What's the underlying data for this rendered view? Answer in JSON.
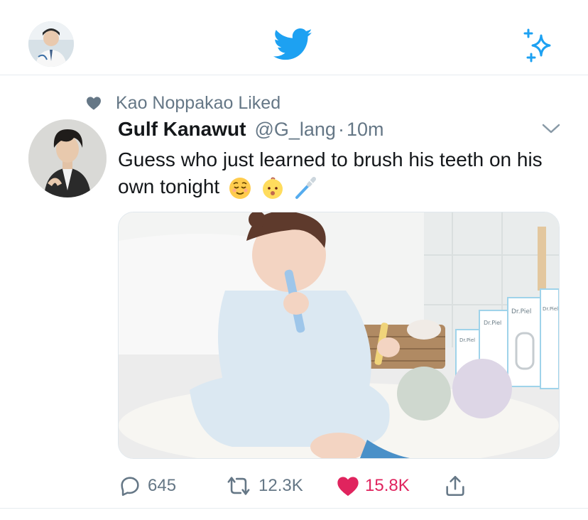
{
  "colors": {
    "twitter_blue": "#1da1f2",
    "gray": "#657786",
    "like_red": "#e0245e"
  },
  "header": {
    "profile_icon": "user-avatar-icon",
    "logo_icon": "twitter-bird-icon",
    "sparkle_icon": "sparkle-icon"
  },
  "context": {
    "icon": "heart-icon",
    "text": "Kao Noppakao Liked"
  },
  "tweet": {
    "display_name": "Gulf Kanawut",
    "handle": "@G_lang",
    "separator": "·",
    "time": "10m",
    "text": "Guess who just learned to brush his teeth on his own tonight",
    "emojis": [
      "relieved-face-icon",
      "baby-face-icon",
      "toothbrush-icon"
    ],
    "media_icon": "photo-baby-brushing-teeth",
    "actions": {
      "replies": "645",
      "retweets": "12.3K",
      "likes": "15.8K",
      "liked": true
    }
  }
}
